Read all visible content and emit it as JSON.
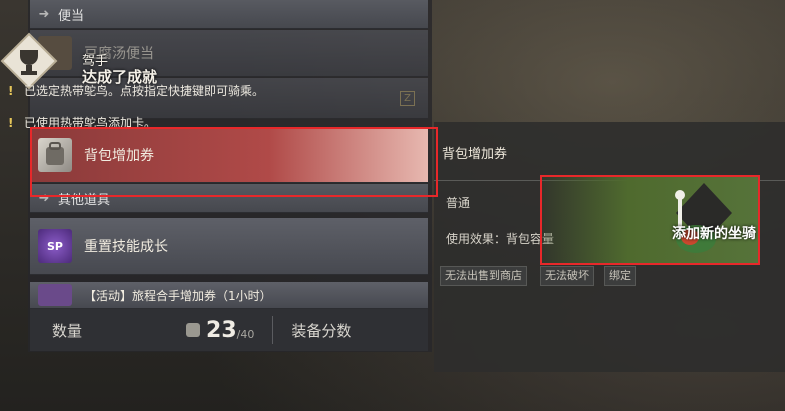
{
  "inventory": {
    "categories": [
      {
        "label": "便当"
      },
      {
        "label": "其他道具"
      }
    ],
    "items": [
      {
        "name": "豆腐汤便当"
      },
      {
        "name": "背包增加券"
      },
      {
        "name": "重置技能成长"
      },
      {
        "name": "【活动】旅程合手增加券（1小时）"
      }
    ],
    "hotkey": "Z",
    "count_label": "数量",
    "count_value": "23",
    "count_max": "/40",
    "gear_score_label": "装备分数"
  },
  "achievement": {
    "title": "达成了成就",
    "subtitle": "驾手"
  },
  "notifications": [
    {
      "text": "已选定热带鸵鸟。点按指定快捷键即可骑乘。"
    },
    {
      "text": "已使用热带鸵鸟添加卡。"
    }
  ],
  "detail": {
    "title": "背包增加券",
    "grade": "普通",
    "effect_label": "使用效果：背包容量",
    "tags": [
      "无法出售到商店",
      "无法破坏",
      "绑定"
    ]
  },
  "toast": {
    "text": "添加新的坐骑"
  },
  "colors": {
    "highlight": "#e8282a",
    "selected_row": "#b04a48",
    "accent_gold": "#e6c65a"
  }
}
